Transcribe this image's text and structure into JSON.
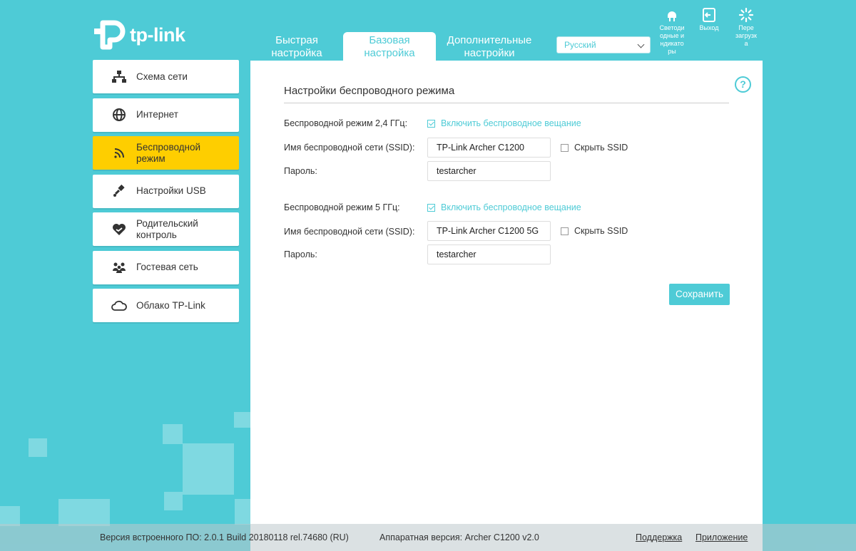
{
  "brand": {
    "logo_text": "tp-link"
  },
  "tabs": [
    {
      "label": "Быстрая\nнастройка",
      "active": false
    },
    {
      "label": "Базовая\nнастройка",
      "active": true
    },
    {
      "label": "Дополнительные\nнастройки",
      "active": false
    }
  ],
  "language": {
    "selected": "Русский"
  },
  "top_actions": {
    "led": "Светоди\nодные и\nндикато\nры",
    "logout": "Выход",
    "reboot": "Пере\nзагрузк\nа"
  },
  "sidebar": {
    "items": [
      {
        "label": "Схема сети",
        "icon": "network-map-icon",
        "active": false
      },
      {
        "label": "Интернет",
        "icon": "globe-icon",
        "active": false
      },
      {
        "label": "Беспроводной\nрежим",
        "icon": "wireless-icon",
        "active": true
      },
      {
        "label": "Настройки USB",
        "icon": "usb-icon",
        "active": false
      },
      {
        "label": "Родительский\nконтроль",
        "icon": "heart-icon",
        "active": false
      },
      {
        "label": "Гостевая сеть",
        "icon": "guests-icon",
        "active": false
      },
      {
        "label": "Облако TP-Link",
        "icon": "cloud-icon",
        "active": false
      }
    ]
  },
  "main": {
    "title": "Настройки беспроводного режима",
    "help": "?",
    "band24": {
      "mode_label": "Беспроводной режим 2,4 ГГц:",
      "enable_label": "Включить беспроводное вещание",
      "enabled": true,
      "ssid_label": "Имя беспроводной сети (SSID):",
      "ssid_value": "TP-Link Archer C1200",
      "hide_label": "Скрыть SSID",
      "hide_checked": false,
      "password_label": "Пароль:",
      "password_value": "testarcher"
    },
    "band5": {
      "mode_label": "Беспроводной режим 5 ГГц:",
      "enable_label": "Включить беспроводное вещание",
      "enabled": true,
      "ssid_label": "Имя беспроводной сети (SSID):",
      "ssid_value": "TP-Link Archer C1200 5G",
      "hide_label": "Скрыть SSID",
      "hide_checked": false,
      "password_label": "Пароль:",
      "password_value": "testarcher"
    },
    "save_label": "Сохранить"
  },
  "footer": {
    "firmware": "Версия встроенного ПО: 2.0.1 Build 20180118 rel.74680 (RU)",
    "hardware": "Аппаратная версия: Archer C1200 v2.0",
    "support": "Поддержка",
    "app": "Приложение"
  },
  "colors": {
    "accent": "#4ecbd6",
    "active_menu": "#fece00",
    "panel": "#ffffff"
  }
}
